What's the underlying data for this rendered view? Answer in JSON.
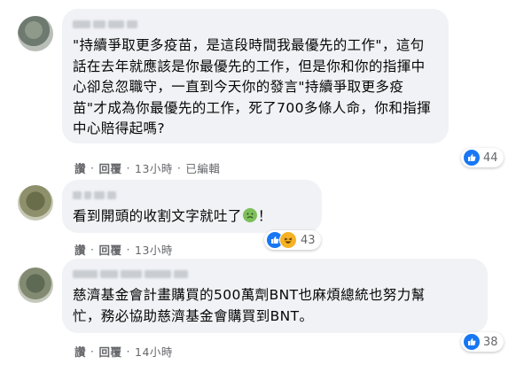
{
  "comments": [
    {
      "avatar_icon": "user-avatar",
      "author_name": "(blurred)",
      "text": "\"持續爭取更多疫苗，是這段時間我最優先的工作\"，這句\n話在去年就應該是你最優先的工作，但是你和你的指揮中\n心卻怠忽職守，一直到今天你的發言\"持續爭取更多疫\n苗\"才成為你最優先的工作，死了700多條人命，你和指揮\n中心賠得起嗎?",
      "actions": {
        "like": "讚",
        "reply": "回覆",
        "time": "13小時",
        "edited": "已編輯"
      },
      "reaction_count": "44",
      "reactions": [
        "like-icon"
      ]
    },
    {
      "avatar_icon": "user-avatar",
      "author_name": "(blurred)",
      "text_before": "看到開頭的收割文字就吐了",
      "text_emoji": "sick-face-emoji",
      "text_after": "！",
      "actions": {
        "like": "讚",
        "reply": "回覆",
        "time": "13小時"
      },
      "reaction_count": "43",
      "reactions": [
        "like-icon",
        "haha-icon"
      ]
    },
    {
      "avatar_icon": "user-avatar",
      "author_name": "(blurred)",
      "text": "慈濟基金會計畫購買的500萬劑BNT也麻煩總統也努力幫\n忙，務必協助慈濟基金會購買到BNT。",
      "actions": {
        "like": "讚",
        "reply": "回覆",
        "time": "14小時"
      },
      "reaction_count": "38",
      "reactions": [
        "like-icon"
      ]
    }
  ],
  "separator": "·",
  "colors": {
    "like": "#1877f2",
    "haha": "#f7b125",
    "bubble": "#f0f2f5",
    "meta": "#65676b"
  }
}
